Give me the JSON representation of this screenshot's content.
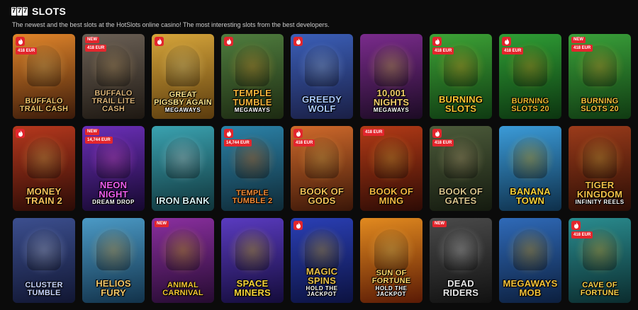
{
  "header": {
    "logo_digits": [
      "7",
      "7",
      "7"
    ],
    "title": "SLOTS",
    "subtitle": "The newest and the best slots at the HotSlots online casino! The most interesting slots from the best developers."
  },
  "badge_colors": {
    "hot": "#e3262d",
    "new": "#e3262d",
    "prize": "#e3262d"
  },
  "games": [
    {
      "name": "Buffalo Trail Cash",
      "sub": "",
      "hot": true,
      "new": false,
      "prize": "418 EUR",
      "bg": [
        "#e1852a",
        "#3a1a0a"
      ],
      "accent": "#f1c46a"
    },
    {
      "name": "Buffalo Trail Lite Cash",
      "sub": "",
      "hot": false,
      "new": true,
      "prize": "418 EUR",
      "bg": [
        "#6b6055",
        "#1e1812"
      ],
      "accent": "#d9b277"
    },
    {
      "name": "Great Pigsby Again",
      "sub": "MEGAWAYS",
      "hot": true,
      "new": false,
      "prize": "",
      "bg": [
        "#d6a53a",
        "#5a3b0e"
      ],
      "accent": "#fbe38a"
    },
    {
      "name": "Temple Tumble",
      "sub": "MEGAWAYS",
      "hot": true,
      "new": false,
      "prize": "",
      "bg": [
        "#4f7d3e",
        "#1d2a12"
      ],
      "accent": "#f3b33a"
    },
    {
      "name": "Greedy Wolf",
      "sub": "",
      "hot": true,
      "new": false,
      "prize": "",
      "bg": [
        "#3b5fb8",
        "#1a1f45"
      ],
      "accent": "#a9c9ff"
    },
    {
      "name": "10,001 Nights",
      "sub": "MEGAWAYS",
      "hot": false,
      "new": false,
      "prize": "",
      "bg": [
        "#7a2b8c",
        "#1c0b24"
      ],
      "accent": "#f2cc6b"
    },
    {
      "name": "Burning Slots",
      "sub": "",
      "hot": true,
      "new": false,
      "prize": "418 EUR",
      "bg": [
        "#3da336",
        "#0f3a12"
      ],
      "accent": "#f7c531"
    },
    {
      "name": "Burning Slots 20",
      "sub": "",
      "hot": true,
      "new": false,
      "prize": "418 EUR",
      "bg": [
        "#2f9e35",
        "#0c3410"
      ],
      "accent": "#e8b82d"
    },
    {
      "name": "Burning Slots 20",
      "sub": "",
      "hot": false,
      "new": true,
      "prize": "418 EUR",
      "bg": [
        "#3aa13a",
        "#103a12"
      ],
      "accent": "#f3c23a"
    },
    {
      "name": "Money Train 2",
      "sub": "",
      "hot": true,
      "new": false,
      "prize": "",
      "bg": [
        "#b6381d",
        "#2a0b06"
      ],
      "accent": "#f9c15a"
    },
    {
      "name": "Neon Night",
      "sub": "DREAM DROP",
      "hot": false,
      "new": true,
      "prize": "14,744 EUR",
      "bg": [
        "#6b2fb8",
        "#15082e"
      ],
      "accent": "#ee5cf0"
    },
    {
      "name": "Iron Bank",
      "sub": "",
      "hot": false,
      "new": false,
      "prize": "",
      "bg": [
        "#3aa2b0",
        "#10343a"
      ],
      "accent": "#d6f1f3"
    },
    {
      "name": "Temple Tumble 2",
      "sub": "",
      "hot": true,
      "new": false,
      "prize": "14,744 EUR",
      "bg": [
        "#2b82a8",
        "#0f2a36"
      ],
      "accent": "#f08a36"
    },
    {
      "name": "Book of Gods",
      "sub": "",
      "hot": true,
      "new": false,
      "prize": "418 EUR",
      "bg": [
        "#d06a2b",
        "#3a1608"
      ],
      "accent": "#f4c257"
    },
    {
      "name": "Book of Ming",
      "sub": "",
      "hot": false,
      "new": false,
      "prize": "418 EUR",
      "bg": [
        "#b33a16",
        "#2d0b05"
      ],
      "accent": "#f5b840"
    },
    {
      "name": "Book of Gates",
      "sub": "",
      "hot": true,
      "new": false,
      "prize": "418 EUR",
      "bg": [
        "#4c5b3a",
        "#141a0f"
      ],
      "accent": "#d5c28a"
    },
    {
      "name": "Banana Town",
      "sub": "",
      "hot": false,
      "new": false,
      "prize": "",
      "bg": [
        "#3b9bd8",
        "#0e2f4a"
      ],
      "accent": "#f7d23b"
    },
    {
      "name": "Tiger Kingdom",
      "sub": "INFINITY REELS",
      "hot": false,
      "new": false,
      "prize": "",
      "bg": [
        "#9b3b1a",
        "#2a0d05"
      ],
      "accent": "#f3c047"
    },
    {
      "name": "Cluster Tumble",
      "sub": "",
      "hot": false,
      "new": false,
      "prize": "",
      "bg": [
        "#3c4f8f",
        "#111632"
      ],
      "accent": "#c9d6ff"
    },
    {
      "name": "Helios Fury",
      "sub": "",
      "hot": false,
      "new": false,
      "prize": "",
      "bg": [
        "#4b9ac6",
        "#12324a"
      ],
      "accent": "#f1c76a"
    },
    {
      "name": "Animal Carnival",
      "sub": "",
      "hot": false,
      "new": true,
      "prize": "",
      "bg": [
        "#8a2f9f",
        "#250b30"
      ],
      "accent": "#f4c535"
    },
    {
      "name": "Space Miners",
      "sub": "",
      "hot": false,
      "new": false,
      "prize": "",
      "bg": [
        "#5a3bc0",
        "#140c3a"
      ],
      "accent": "#f5d23a"
    },
    {
      "name": "Magic Spins",
      "sub": "HOLD THE JACKPOT",
      "hot": true,
      "new": false,
      "prize": "",
      "bg": [
        "#2a3fb5",
        "#0c1240"
      ],
      "accent": "#e7c04b"
    },
    {
      "name": "Sun of Fortune",
      "sub": "HOLD THE JACKPOT",
      "hot": false,
      "new": false,
      "prize": "",
      "bg": [
        "#e28a1f",
        "#5a1a05"
      ],
      "accent": "#ffd86a"
    },
    {
      "name": "Dead Riders",
      "sub": "",
      "hot": false,
      "new": true,
      "prize": "",
      "bg": [
        "#4a4a4a",
        "#111111"
      ],
      "accent": "#e7e7e7"
    },
    {
      "name": "Megaways Mob",
      "sub": "",
      "hot": false,
      "new": false,
      "prize": "",
      "bg": [
        "#2f6ab8",
        "#0c1f3e"
      ],
      "accent": "#f3c13a"
    },
    {
      "name": "Cave of Fortune",
      "sub": "",
      "hot": true,
      "new": false,
      "prize": "418 EUR",
      "bg": [
        "#2a8c8f",
        "#0b2c2e"
      ],
      "accent": "#f7d04a"
    }
  ]
}
